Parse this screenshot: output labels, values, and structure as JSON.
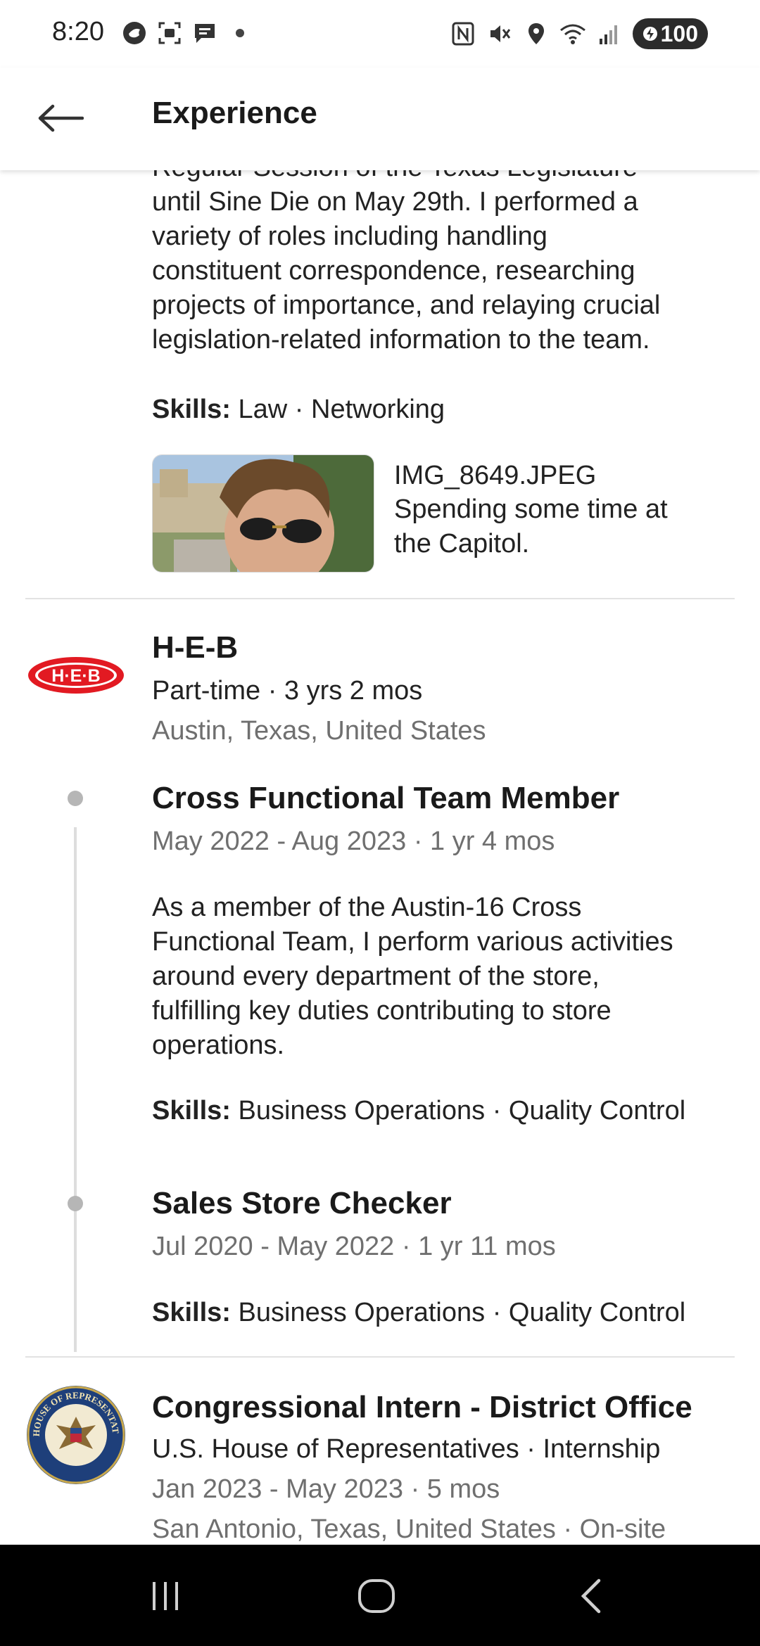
{
  "status_bar": {
    "time": "8:20",
    "battery": "100",
    "icons_left": [
      "bird-icon",
      "screenshot-icon",
      "message-icon",
      "dot-icon"
    ],
    "icons_right": [
      "nfc-icon",
      "mute-icon",
      "location-icon",
      "wifi-icon",
      "signal-icon"
    ]
  },
  "header": {
    "title": "Experience",
    "back_icon": "arrow-left-icon"
  },
  "capitol_entry": {
    "description_lines": [
      "Regular Session of the Texas Legislature",
      "until Sine Die on May 29th. I performed a",
      "variety of roles including handling",
      "constituent correspondence, researching",
      "projects of importance, and relaying crucial",
      "legislation-related information to the team."
    ],
    "skills_label": "Skills:",
    "skills": "Law · Networking",
    "media_title": "IMG_8649.JPEG",
    "media_desc_lines": [
      "Spending some time at",
      "the Capitol."
    ]
  },
  "heb": {
    "logo_text": "H·E·B",
    "name": "H-E-B",
    "employment": "Part-time · 3 yrs 2 mos",
    "location": "Austin, Texas, United States",
    "roles": [
      {
        "title": "Cross Functional Team Member",
        "dates": "May 2022 - Aug 2023 · 1 yr 4 mos",
        "description_lines": [
          "As a member of the Austin-16 Cross",
          "Functional Team, I perform various activities",
          "around every department of the store,",
          "fulfilling key duties contributing to store",
          "operations."
        ],
        "skills_label": "Skills:",
        "skills": "Business Operations · Quality Control"
      },
      {
        "title": "Sales Store Checker",
        "dates": "Jul 2020 - May 2022 · 1 yr 11 mos",
        "skills_label": "Skills:",
        "skills": "Business Operations · Quality Control"
      }
    ]
  },
  "house": {
    "seal_text": "U.S. HOUSE OF REPRESENTATIVES",
    "title": "Congressional Intern - District Office",
    "org": "U.S. House of Representatives · Internship",
    "dates": "Jan 2023 - May 2023 · 5 mos",
    "location": "San Antonio, Texas, United States · On-site"
  },
  "nav": {
    "recents_icon": "recents-icon",
    "home_icon": "home-icon",
    "back_icon": "back-icon"
  },
  "colors": {
    "heb_red": "#e21a22",
    "seal_blue": "#1e3f7a",
    "seal_gold": "#c9a84c"
  }
}
